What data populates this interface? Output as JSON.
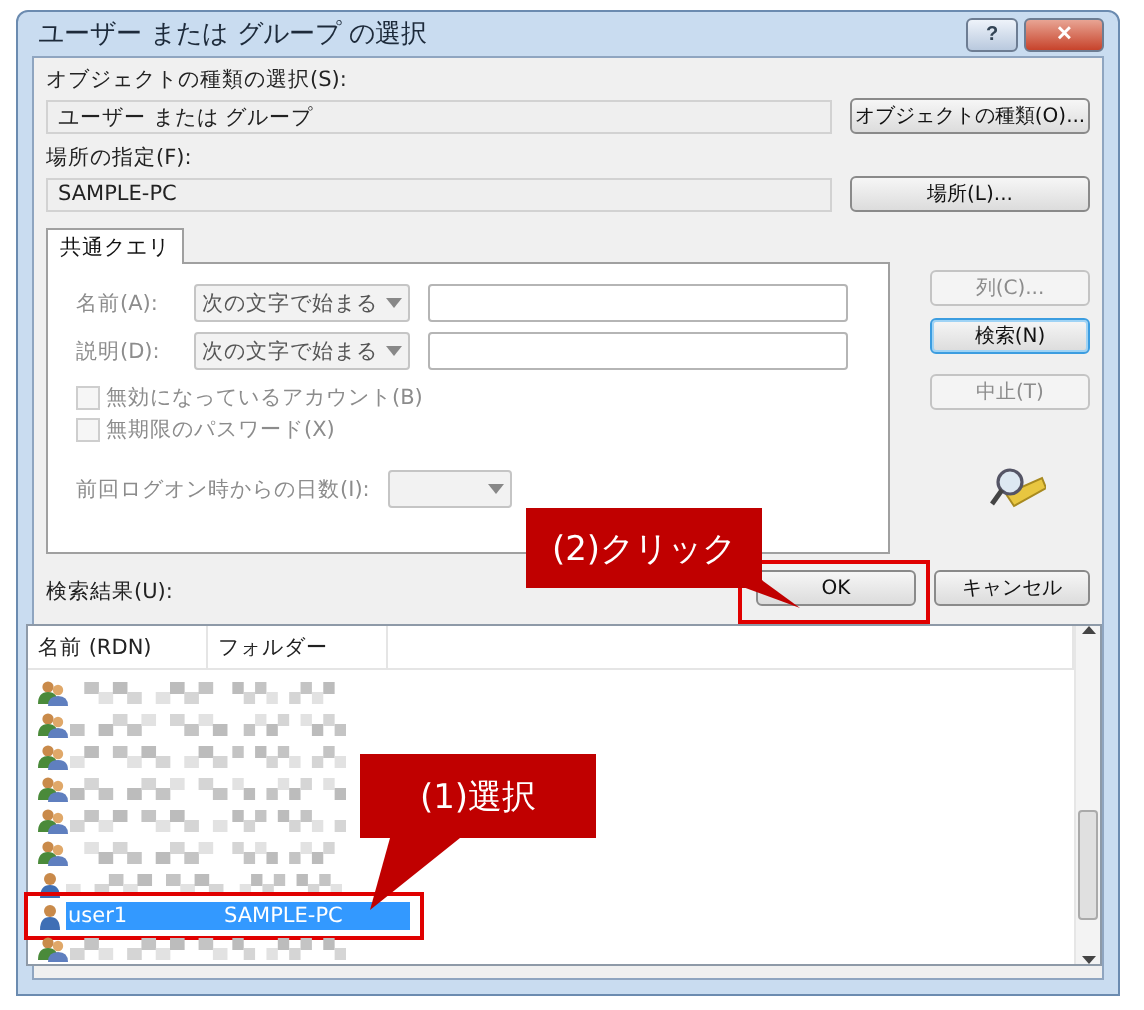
{
  "window": {
    "title": "ユーザー または グループ の選択",
    "help_button": "?",
    "close_button": "✕"
  },
  "object_type": {
    "label": "オブジェクトの種類の選択(S):",
    "value": "ユーザー または グループ",
    "button": "オブジェクトの種類(O)..."
  },
  "location": {
    "label": "場所の指定(F):",
    "value": "SAMPLE-PC",
    "button": "場所(L)..."
  },
  "tabs": [
    {
      "label": "共通クエリ",
      "selected": true
    }
  ],
  "query": {
    "name_label": "名前(A):",
    "name_mode": "次の文字で始まる",
    "desc_label": "説明(D):",
    "desc_mode": "次の文字で始まる",
    "checkboxes": [
      {
        "label": "無効になっているアカウント(B)",
        "checked": false,
        "disabled": true
      },
      {
        "label": "無期限のパスワード(X)",
        "checked": false,
        "disabled": true
      }
    ],
    "days_label": "前回ログオン時からの日数(I):"
  },
  "side_buttons": [
    {
      "label": "列(C)...",
      "disabled": true,
      "default": false
    },
    {
      "label": "検索(N)",
      "disabled": false,
      "default": true
    },
    {
      "label": "中止(T)",
      "disabled": true,
      "default": false
    }
  ],
  "ok_button": "OK",
  "cancel_button": "キャンセル",
  "results": {
    "label": "検索結果(U):",
    "columns": [
      "名前 (RDN)",
      "フォルダー"
    ],
    "rows": [
      {
        "kind": "group",
        "redacted": true,
        "selected": false
      },
      {
        "kind": "group",
        "redacted": true,
        "selected": false
      },
      {
        "kind": "group",
        "redacted": true,
        "selected": false
      },
      {
        "kind": "group",
        "redacted": true,
        "selected": false
      },
      {
        "kind": "group",
        "redacted": true,
        "selected": false
      },
      {
        "kind": "group",
        "redacted": true,
        "selected": false
      },
      {
        "kind": "user",
        "redacted": true,
        "selected": false
      },
      {
        "kind": "user",
        "redacted": false,
        "selected": true,
        "name": "user1",
        "folder": "SAMPLE-PC"
      },
      {
        "kind": "group",
        "redacted": true,
        "selected": false
      }
    ]
  },
  "annotations": {
    "click_callout": "(2)クリック",
    "select_callout": "(1)選択"
  }
}
